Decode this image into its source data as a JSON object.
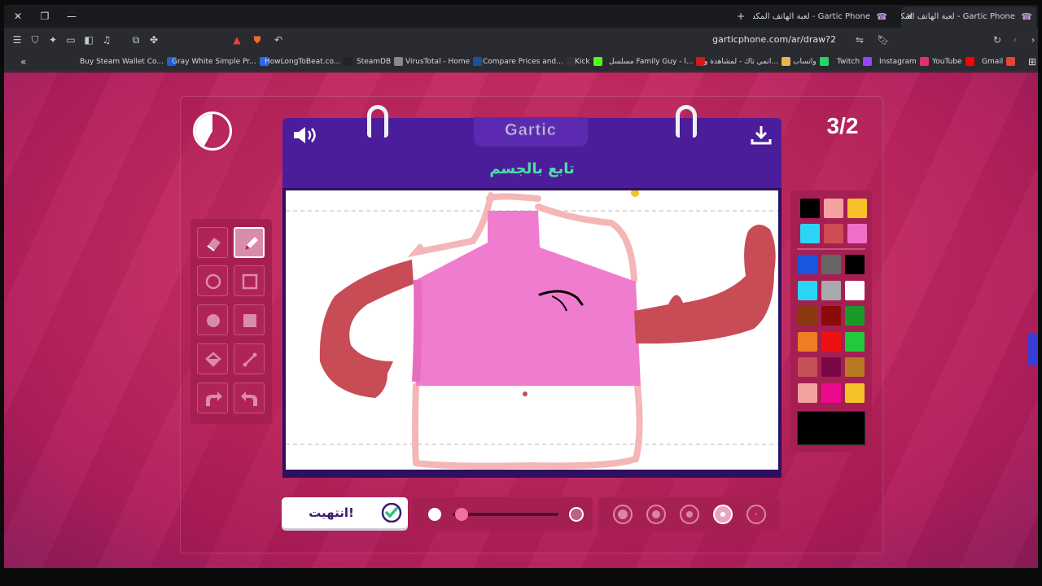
{
  "browser": {
    "tabs": [
      {
        "title": "Gartic Phone - لعبة الهاتف المكسور",
        "active": false
      },
      {
        "title": "Gartic Phone - لعبة الهاتف المكسور",
        "active": true
      }
    ],
    "new_tab_icon": "plus-icon",
    "url": "garticphone.com/ar/draw?2"
  },
  "bookmarks": [
    {
      "label": "Buy Steam Wallet Co...",
      "icon_color": "#1b5fd1"
    },
    {
      "label": "Gray White Simple Pr...",
      "icon_color": "#2a68e8"
    },
    {
      "label": "HowLongToBeat.co...",
      "icon_color": "#222222"
    },
    {
      "label": "SteamDB",
      "icon_color": "#888888"
    },
    {
      "label": "VirusTotal - Home",
      "icon_color": "#1a50a8"
    },
    {
      "label": "Compare Prices and...",
      "icon_color": "#333333"
    },
    {
      "label": "Kick",
      "icon_color": "#53fc18"
    },
    {
      "label": "مسلسل Family Guy - ا...",
      "icon_color": "#d01b1b"
    },
    {
      "label": "انمي تاك - لمشاهدة و...",
      "icon_color": "#e8b64a"
    },
    {
      "label": "واتساب",
      "icon_color": "#25d366"
    },
    {
      "label": "Twitch",
      "icon_color": "#9146ff"
    },
    {
      "label": "Instagram",
      "icon_color": "#e1306c"
    },
    {
      "label": "YouTube",
      "icon_color": "#ff0000"
    },
    {
      "label": "Gmail",
      "icon_color": "#ea4335"
    }
  ],
  "game": {
    "logo": "Gartic",
    "round": "3/2",
    "prompt": "تابع بالجسم",
    "done_label": "انتهيت!",
    "accent_color": "#4c1d9a",
    "prompt_color": "#48e0a4",
    "tools": [
      {
        "name": "eraser-tool",
        "icon": "eraser-icon"
      },
      {
        "name": "pencil-tool",
        "icon": "pencil-icon",
        "selected": true
      },
      {
        "name": "ellipse-outline-tool",
        "icon": "circle-outline-icon"
      },
      {
        "name": "rect-outline-tool",
        "icon": "square-outline-icon"
      },
      {
        "name": "ellipse-fill-tool",
        "icon": "circle-filled-icon"
      },
      {
        "name": "rect-fill-tool",
        "icon": "square-filled-icon"
      },
      {
        "name": "fill-bucket-tool",
        "icon": "paint-bucket-icon"
      },
      {
        "name": "line-tool",
        "icon": "line-icon"
      },
      {
        "name": "undo-tool",
        "icon": "undo-icon"
      },
      {
        "name": "redo-tool",
        "icon": "redo-icon"
      }
    ],
    "palette_top": [
      "#000000",
      "#f4a2a0",
      "#f7c12a",
      "#2bd5f7",
      "#d04c54",
      "#f26fc8"
    ],
    "palette_grid": [
      "#1858e0",
      "#666666",
      "#000000",
      "#2bd5f7",
      "#aaaaaa",
      "#ffffff",
      "#8a3a0e",
      "#8b0b0b",
      "#1a9a28",
      "#ee7d24",
      "#ee1111",
      "#22c93c",
      "#c5505a",
      "#7a0846",
      "#b57a22",
      "#f4a2a0",
      "#ee0a8c",
      "#f7c12a"
    ],
    "current_color": "#000000",
    "opacity_level": 0.05,
    "brush_sizes": 5,
    "selected_brush_size": 4
  }
}
